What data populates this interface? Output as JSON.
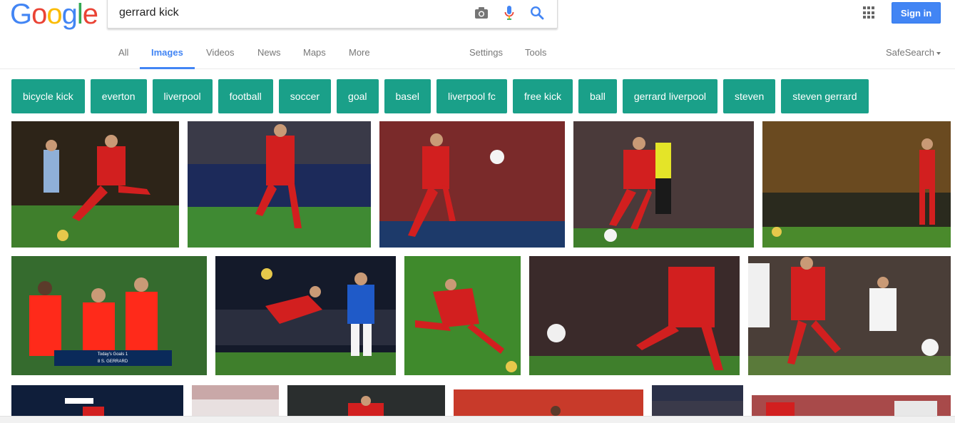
{
  "logo": {
    "letters": [
      "G",
      "o",
      "o",
      "g",
      "l",
      "e"
    ]
  },
  "search": {
    "query": "gerrard kick"
  },
  "header": {
    "signin_label": "Sign in"
  },
  "tabs": [
    {
      "label": "All"
    },
    {
      "label": "Images"
    },
    {
      "label": "Videos"
    },
    {
      "label": "News"
    },
    {
      "label": "Maps"
    },
    {
      "label": "More"
    },
    {
      "label": "Settings"
    },
    {
      "label": "Tools"
    }
  ],
  "safesearch": {
    "label": "SafeSearch"
  },
  "chips": [
    "bicycle kick",
    "everton",
    "liverpool",
    "football",
    "soccer",
    "goal",
    "basel",
    "liverpool fc",
    "free kick",
    "ball",
    "gerrard liverpool",
    "steven",
    "steven gerrard"
  ],
  "colors": {
    "accent": "#4285f4",
    "chip": "#1aa089",
    "pitch": "#3f7f2c",
    "kit_red": "#d21f1f"
  },
  "overlay": {
    "goals_title": "Today's Goals 1",
    "goals_player": "8 S. GERRARD"
  }
}
